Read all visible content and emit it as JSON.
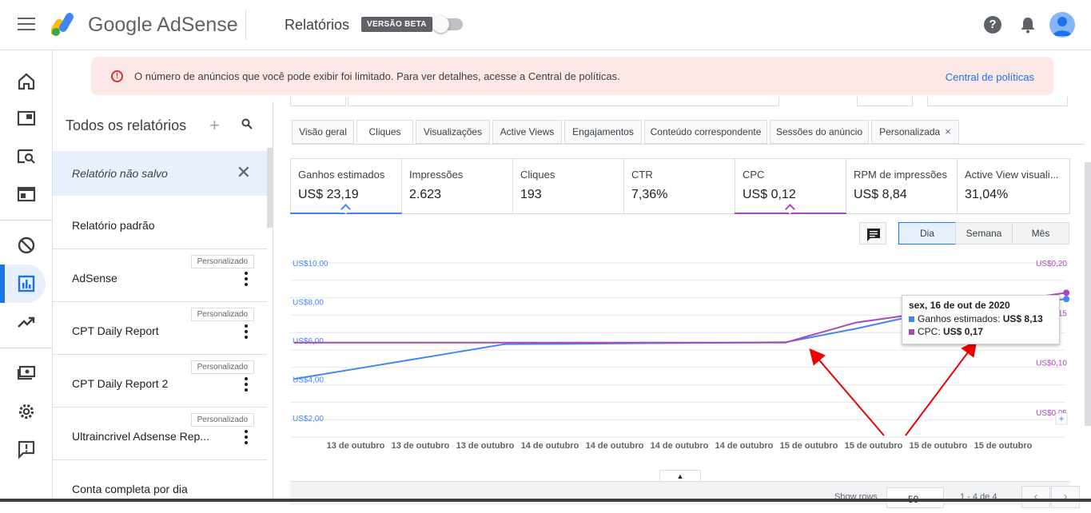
{
  "header": {
    "brand": "Google AdSense",
    "section_title": "Relatórios",
    "beta_badge": "VERSÃO BETA",
    "help_label": "?"
  },
  "leftnav": {
    "items": [
      {
        "icon": "home-icon"
      },
      {
        "icon": "ads-icon"
      },
      {
        "icon": "sites-search-icon"
      },
      {
        "icon": "ad-units-icon"
      },
      {
        "icon": "blocking-controls-icon"
      },
      {
        "icon": "reports-icon",
        "active": true
      },
      {
        "icon": "optimization-icon"
      },
      {
        "icon": "payments-icon"
      },
      {
        "icon": "settings-icon"
      },
      {
        "icon": "feedback-icon"
      }
    ]
  },
  "banner": {
    "message": "O número de anúncios que você pode exibir foi limitado. Para ver detalhes, acesse a Central de políticas.",
    "link": "Central de políticas"
  },
  "reports_panel": {
    "title": "Todos os relatórios",
    "add_label": "+",
    "items": [
      {
        "label": "Relatório não salvo",
        "badge": "",
        "unsaved": true
      },
      {
        "label": "Relatório padrão",
        "badge": ""
      },
      {
        "label": "AdSense",
        "badge": "Personalizado"
      },
      {
        "label": "CPT Daily Report",
        "badge": "Personalizado"
      },
      {
        "label": "CPT Daily Report 2",
        "badge": "Personalizado"
      },
      {
        "label": "Ultraincrivel Adsense Rep...",
        "badge": "Personalizado"
      },
      {
        "label": "Conta completa por dia",
        "badge": ""
      }
    ]
  },
  "tabs": [
    {
      "label": "Visão geral"
    },
    {
      "label": "Cliques",
      "active": true
    },
    {
      "label": "Visualizações"
    },
    {
      "label": "Active Views"
    },
    {
      "label": "Engajamentos"
    },
    {
      "label": "Conteúdo correspondente"
    },
    {
      "label": "Sessões do anúncio"
    },
    {
      "label": "Personalizada",
      "closable": true,
      "close_glyph": "×"
    }
  ],
  "metrics": [
    {
      "label": "Ganhos estimados",
      "value": "US$ 23,19",
      "selected_color": "#4285f4"
    },
    {
      "label": "Impressões",
      "value": "2.623"
    },
    {
      "label": "Cliques",
      "value": "193"
    },
    {
      "label": "CTR",
      "value": "7,36%"
    },
    {
      "label": "CPC",
      "value": "US$ 0,12",
      "selected_color": "#ab47bc"
    },
    {
      "label": "RPM de impressões",
      "value": "US$ 8,84"
    },
    {
      "label": "Active View visuali...",
      "value": "31,04%"
    }
  ],
  "granularity": {
    "options": [
      "Dia",
      "Semana",
      "Mês"
    ],
    "selected": "Dia"
  },
  "chart_data": {
    "type": "line",
    "categories": [
      "13 de outubro",
      "13 de outubro",
      "13 de outubro",
      "14 de outubro",
      "14 de outubro",
      "14 de outubro",
      "14 de outubro",
      "15 de outubro",
      "15 de outubro",
      "15 de outubro",
      "15 de outubro",
      "16 de outubro"
    ],
    "series": [
      {
        "name": "Ganhos estimados",
        "axis": "left",
        "color": "#4285f4",
        "values": [
          4.0,
          4.6,
          5.2,
          5.8,
          5.82,
          5.85,
          5.87,
          5.9,
          6.6,
          7.4,
          7.8,
          8.13
        ]
      },
      {
        "name": "CPC",
        "axis": "right",
        "color": "#ab47bc",
        "values": [
          0.12,
          0.12,
          0.12,
          0.12,
          0.12,
          0.12,
          0.12,
          0.12,
          0.14,
          0.15,
          0.16,
          0.17
        ]
      }
    ],
    "left_ticks": [
      "US$10,00",
      "US$8,00",
      "US$6,00",
      "US$4,00",
      "US$2,00"
    ],
    "right_ticks": [
      "US$0,20",
      "US$0,15",
      "US$0,10",
      "US$0,05"
    ],
    "x_tick_labels": [
      "13 de outubro",
      "13 de outubro",
      "13 de outubro",
      "14 de outubro",
      "14 de outubro",
      "14 de outubro",
      "14 de outubro",
      "15 de outubro",
      "15 de outubro",
      "15 de outubro",
      "15 de outubro"
    ],
    "ylim_left": [
      1.0,
      10.0
    ],
    "ylim_right": [
      0.025,
      0.2
    ],
    "grid": true,
    "tooltip": {
      "title": "sex, 16 de out de 2020",
      "rows": [
        {
          "label": "Ganhos estimados:",
          "value": "US$ 8,13",
          "color": "#4285f4"
        },
        {
          "label": "CPC:",
          "value": "US$ 0,17",
          "color": "#ab47bc"
        }
      ]
    },
    "annotation": "red arrows pointing to series inflection and tooltip"
  },
  "table_footer": {
    "show_rows_label": "Show rows",
    "rows_value": "50",
    "range": "1 - 4 de 4",
    "prev_glyph": "‹",
    "next_glyph": "›",
    "collapse_glyph": "▲"
  }
}
